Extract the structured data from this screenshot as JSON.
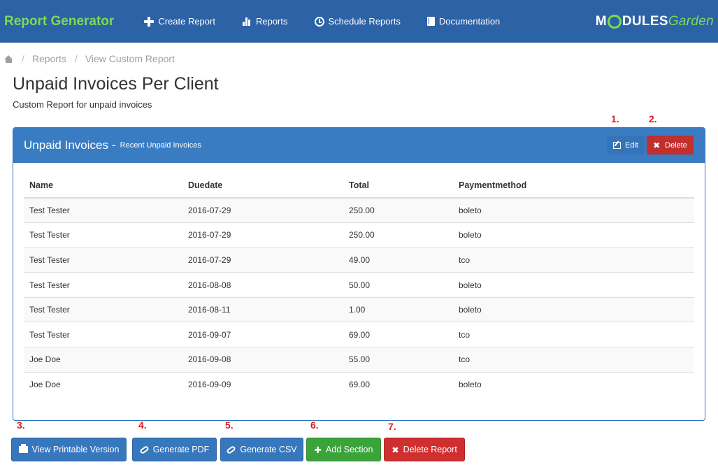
{
  "app": {
    "brand": "Report Generator"
  },
  "nav": [
    {
      "label": "Create Report",
      "icon": "plus-icon"
    },
    {
      "label": "Reports",
      "icon": "bar-chart-icon"
    },
    {
      "label": "Schedule Reports",
      "icon": "clock-icon"
    },
    {
      "label": "Documentation",
      "icon": "book-icon"
    }
  ],
  "logo": {
    "part1": "M",
    "part2": "DULES",
    "part3": "Garden"
  },
  "breadcrumb": {
    "items": [
      "Reports",
      "View Custom Report"
    ],
    "separator": "/"
  },
  "page": {
    "title": "Unpaid Invoices Per Client",
    "subtitle": "Custom Report for unpaid invoices"
  },
  "markers": [
    "1.",
    "2.",
    "3.",
    "4.",
    "5.",
    "6.",
    "7."
  ],
  "panel": {
    "title": "Unpaid Invoices",
    "separator": "-",
    "subtitle": "Recent Unpaid Invoices",
    "edit_label": "Edit",
    "delete_label": "Delete"
  },
  "table": {
    "columns": [
      "Name",
      "Duedate",
      "Total",
      "Paymentmethod"
    ],
    "rows": [
      [
        "Test Tester",
        "2016-07-29",
        "250.00",
        "boleto"
      ],
      [
        "Test Tester",
        "2016-07-29",
        "250.00",
        "boleto"
      ],
      [
        "Test Tester",
        "2016-07-29",
        "49.00",
        "tco"
      ],
      [
        "Test Tester",
        "2016-08-08",
        "50.00",
        "boleto"
      ],
      [
        "Test Tester",
        "2016-08-11",
        "1.00",
        "boleto"
      ],
      [
        "Test Tester",
        "2016-09-07",
        "69.00",
        "tco"
      ],
      [
        "Joe Doe",
        "2016-09-08",
        "55.00",
        "tco"
      ],
      [
        "Joe Doe",
        "2016-09-09",
        "69.00",
        "boleto"
      ]
    ]
  },
  "actions": {
    "printable": "View Printable Version",
    "pdf": "Generate PDF",
    "csv": "Generate CSV",
    "add_section": "Add Section",
    "delete_report": "Delete Report"
  },
  "colors": {
    "header": "#2c62a6",
    "brand_green": "#7ed957",
    "panel": "#3a7cc1",
    "danger": "#d02f2f",
    "success": "#3aa43a",
    "marker": "#e01b1b"
  }
}
